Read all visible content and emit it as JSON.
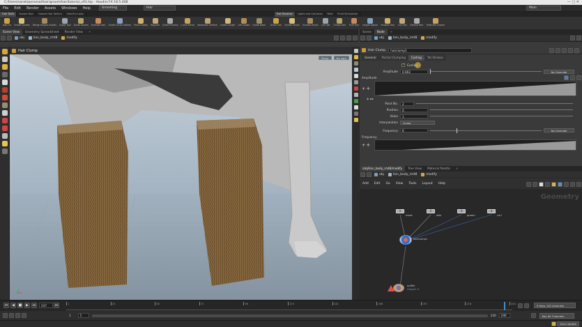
{
  "window": {
    "title": "C:/Users/sarah/personal/hair/groom/hair/tutorial_v01.hip - Houdini FX 18.5.408"
  },
  "menu": {
    "items": [
      "File",
      "Edit",
      "Render",
      "Assets",
      "Windows",
      "Help"
    ],
    "workspace": "Grooming",
    "context": "Hair",
    "desktop": "Main"
  },
  "shelf": {
    "tabs_left": [
      "Hair Tools",
      "Groom Hair",
      "Groom Hair Vellum",
      "Hair/Fur Labs"
    ],
    "tabs_right": [
      "Hair Brushes",
      "Lights and Cameras",
      "Rest",
      "Fluid Simulation"
    ],
    "tools_left": [
      "Add Fur",
      "Create Guides",
      "Merge Unique Guides",
      "Guide Tool",
      "Guide Groom",
      "Animate Hair",
      "Guide Curve Deform",
      "Paint Guides",
      "Reguide",
      "Guide Process",
      "Curve Mirror",
      "Advection Deform",
      "Guide Length",
      "Lift Guides",
      "Guide Mask"
    ],
    "tools_right": [
      "Draw Hair",
      "Screen Brush",
      "Surface Brush",
      "Lift Hair",
      "Clump Hair",
      "Fluff Hair",
      "Length Adjust",
      "Smooth Hair",
      "Cut Hair",
      "Extend Hair",
      "Multi-File Groom"
    ]
  },
  "left_panel": {
    "tabs": [
      "Scene View",
      "Geometry Spreadsheet",
      "Render View"
    ],
    "path": [
      "obj",
      "lion_body_rmt8",
      "modify"
    ],
    "tool_title": "Hair Clump",
    "view_menus": [
      "Persp",
      "No cam"
    ]
  },
  "params_panel": {
    "tabs": [
      "Scene",
      "Node"
    ],
    "path": [
      "obj",
      "lion_body_rmt8",
      "modify"
    ],
    "node_type": "Hair Clump",
    "node_name": "hairclump1",
    "sub_tabs": [
      "General",
      "Partial Clumping",
      "Curling",
      "Tet Strokes"
    ],
    "active_sub_tab": "Curling",
    "enable_label": "Curling",
    "amplitude_label": "Amplitude",
    "amplitude_value": "0.002",
    "override_label": "No Override",
    "ramp_section": "Amplitude",
    "point_no_label": "Point No.",
    "point_no_value": "2",
    "position_label": "Position",
    "position_value": "0",
    "value_label": "Value",
    "value_value": "1",
    "interpolation_label": "Interpolation",
    "interpolation_value": "Linear",
    "frequency_label": "Frequency",
    "frequency_value": "6",
    "frequency_override": "No Override",
    "ramp2_section": "Frequency"
  },
  "network_panel": {
    "tabs": [
      "/obj/lion_body_rmt8/modify",
      "Tree View",
      "Material Palette"
    ],
    "path": [
      "obj",
      "lion_body_rmt8",
      "modify"
    ],
    "menus": [
      "Add",
      "Edit",
      "Go",
      "View",
      "Tools",
      "Layout",
      "Help"
    ],
    "watermark": "Geometry",
    "inputs": [
      {
        "num": "1",
        "label": "mask"
      },
      {
        "num": "2",
        "label": "skin"
      },
      {
        "num": "3",
        "label": "groom"
      },
      {
        "num": "4",
        "label": "curl"
      }
    ],
    "clump_node_label": "hairclump1",
    "output_node_label": "outfile",
    "output_node_sub": "Output: 0"
  },
  "timeline": {
    "ticks": [
      "1",
      "24",
      "48",
      "72",
      "96",
      "120",
      "144",
      "168",
      "192",
      "216",
      "240"
    ],
    "current_frame": "237"
  },
  "playbar": {
    "start": "1",
    "start2": "1",
    "end": "240",
    "end2": "240",
    "keys_info": "0 keys, 0/0 channels",
    "key_all": "Key All Channels"
  },
  "status": {
    "auto_update": "Auto Update"
  },
  "colors": {
    "accent": "#e6b43c",
    "ui_bg": "#3a3a3a",
    "fur": "#7a5c36"
  }
}
